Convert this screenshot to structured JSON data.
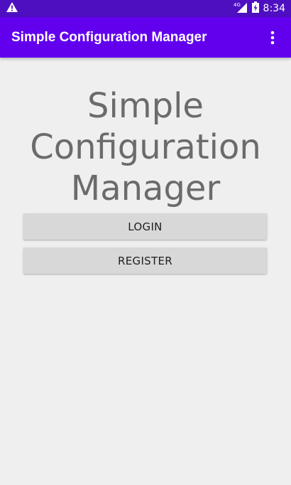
{
  "status_bar": {
    "time": "8:34",
    "network": "4G",
    "icons": [
      "warning-icon",
      "signal-icon",
      "battery-icon"
    ],
    "background": "#4e0fc1"
  },
  "app_bar": {
    "title": "Simple Configuration Manager",
    "menu_icon": "more-vert-icon",
    "background": "#6200ee"
  },
  "main": {
    "headline_lines": [
      "Simple",
      "Configuration",
      "Manager"
    ],
    "login_label": "LOGIN",
    "register_label": "REGISTER",
    "headline_color": "#6b6b6b"
  }
}
